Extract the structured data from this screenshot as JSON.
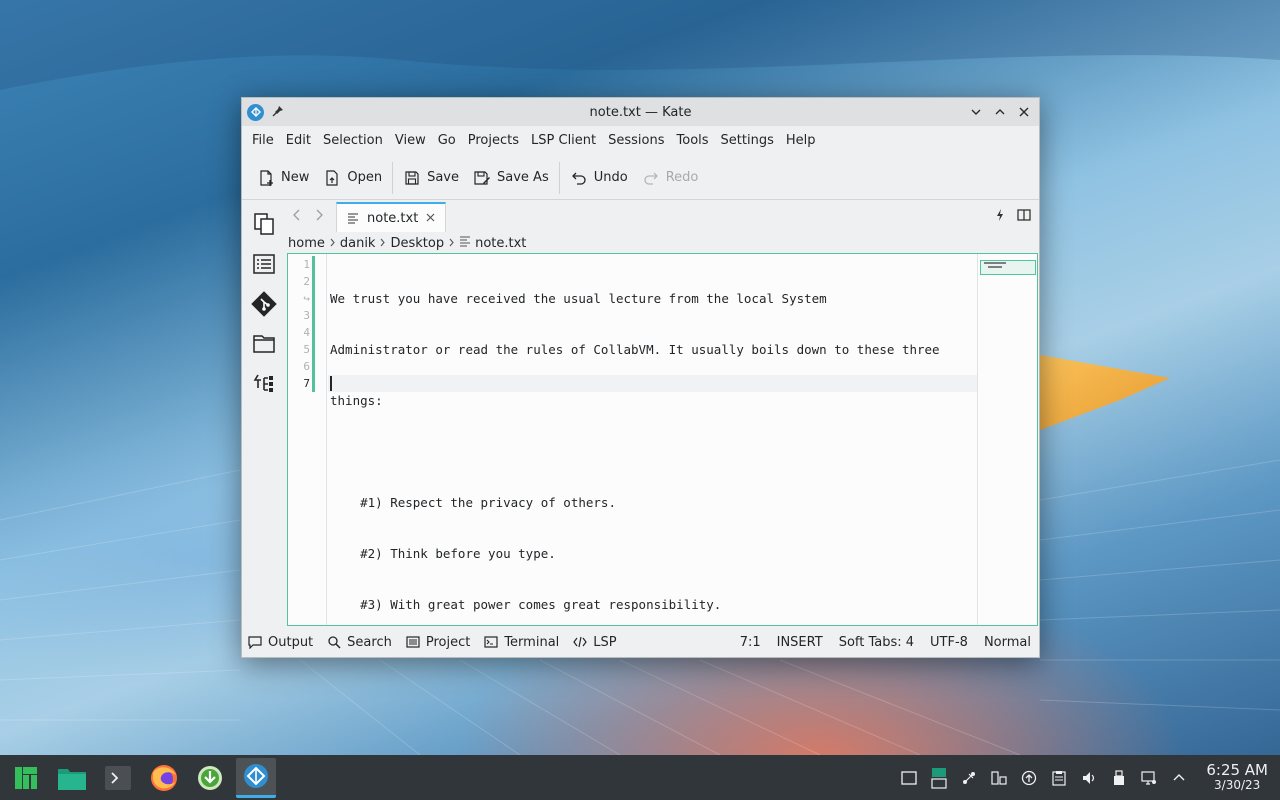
{
  "window": {
    "title": "note.txt — Kate"
  },
  "menubar": [
    "File",
    "Edit",
    "Selection",
    "View",
    "Go",
    "Projects",
    "LSP Client",
    "Sessions",
    "Tools",
    "Settings",
    "Help"
  ],
  "toolbar": {
    "new": "New",
    "open": "Open",
    "save": "Save",
    "save_as": "Save As",
    "undo": "Undo",
    "redo": "Redo"
  },
  "tab": {
    "label": "note.txt"
  },
  "breadcrumb": [
    "home",
    "danik",
    "Desktop",
    "note.txt"
  ],
  "editor": {
    "line_numbers": [
      "1",
      "2",
      "",
      "3",
      "4",
      "5",
      "6",
      "7"
    ],
    "lines": [
      "We trust you have received the usual lecture from the local System",
      "Administrator or read the rules of CollabVM. It usually boils down to these three",
      "things:",
      "",
      "    #1) Respect the privacy of others.",
      "    #2) Think before you type.",
      "    #3) With great power comes great responsibility.",
      ""
    ]
  },
  "statusbar": {
    "left": [
      "Output",
      "Search",
      "Project",
      "Terminal",
      "LSP"
    ],
    "position": "7:1",
    "mode": "INSERT",
    "tabs": "Soft Tabs: 4",
    "encoding": "UTF-8",
    "syntax": "Normal"
  },
  "taskbar": {
    "apps": [
      "manjaro-menu",
      "file-manager",
      "terminal",
      "firefox",
      "downloader",
      "kate"
    ],
    "clock_time": "6:25 AM",
    "clock_date": "3/30/23"
  },
  "colors": {
    "accent": "#3daee9",
    "modified": "#52c39a",
    "taskbar": "#31363b"
  }
}
